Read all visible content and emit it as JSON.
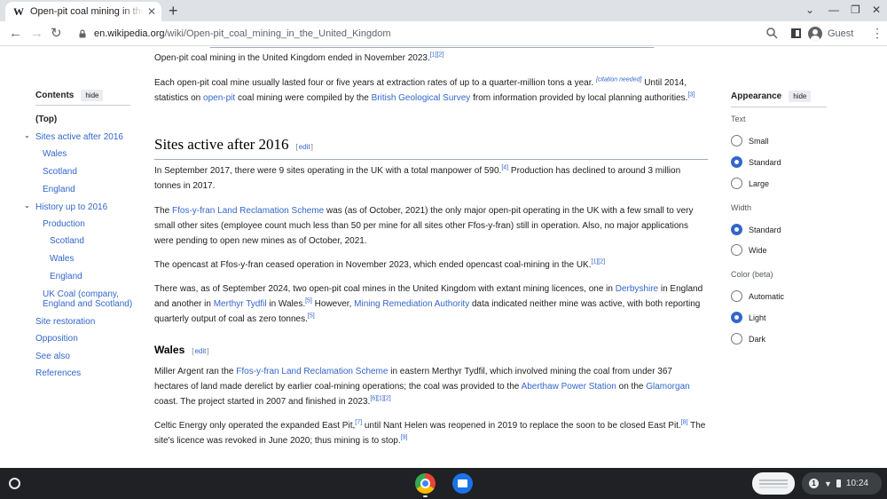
{
  "browser": {
    "tab_title": "Open-pit coal mining in the United Kingdom - Wikipedia",
    "favicon": "W",
    "new_tab": "+",
    "url_host": "en.wikipedia.org",
    "url_path": "/wiki/Open-pit_coal_mining_in_the_United_Kingdom",
    "profile": "Guest"
  },
  "toc": {
    "heading": "Contents",
    "hide": "hide",
    "items": [
      "(Top)",
      "Sites active after 2016",
      "Wales",
      "Scotland",
      "England",
      "History up to 2016",
      "Production",
      "Scotland",
      "Wales",
      "England",
      "UK Coal (company, England and Scotland)",
      "Site restoration",
      "Opposition",
      "See also",
      "References"
    ]
  },
  "article": {
    "p0": {
      "text": "Open-pit coal mining in the United Kingdom ended in November 2023.",
      "ref": "[1][2]"
    },
    "p1": {
      "a": "Each open-pit coal mine usually lasted four or five years at extraction rates of up to a quarter-million tons a year.",
      "cn": "[citation needed]",
      "b": " Until 2014, statistics on ",
      "link1": "open-pit",
      "c": " coal mining were compiled by the ",
      "link2": "British Geological Survey",
      "d": " from information provided by local planning authorities.",
      "ref": "[3]"
    },
    "h2": "Sites active after 2016",
    "edit": "edit",
    "p2": {
      "a": "In September 2017, there were 9 sites operating in the UK with a total manpower of 590.",
      "ref": "[4]",
      "b": " Production has declined to around 3 million tonnes in 2017."
    },
    "p3": {
      "a": "The ",
      "link": "Ffos-y-fran Land Reclamation Scheme",
      "b": " was (as of October, 2021) the only major open-pit operating in the UK with a few small to very small other sites (employee count much less than 50 per mine for all sites other Ffos-y-fran) still in operation. Also, no major applications were pending to open new mines as of October, 2021."
    },
    "p4": {
      "a": "The opencast at Ffos-y-fran ceased operation in November 2023, which ended opencast coal-mining in the UK.",
      "ref": "[1][2]"
    },
    "p5": {
      "a": "There was, as of September 2024, two open-pit coal mines in the United Kingdom with extant mining licences, one in ",
      "link1": "Derbyshire",
      "b": " in England and another in ",
      "link2": "Merthyr Tydfil",
      "c": " in Wales.",
      "ref1": "[5]",
      "d": " However, ",
      "link3": "Mining Remediation Authority",
      "e": " data indicated neither mine was active, with both reporting quarterly output of coal as zero tonnes.",
      "ref2": "[5]"
    },
    "h3": "Wales",
    "p6": {
      "a": "Miller Argent ran the ",
      "link1": "Ffos-y-fran Land Reclamation Scheme",
      "b": " in eastern Merthyr Tydfil, which involved mining the coal from under 367 hectares of land made derelict by earlier coal-mining operations; the coal was provided to the ",
      "link2": "Aberthaw Power Station",
      "c": " on the ",
      "link3": "Glamorgan",
      "d": " coast. The project started in 2007 and finished in 2023.",
      "ref": "[6][1][2]"
    },
    "p7": {
      "a": "Celtic Energy only operated the expanded East Pit,",
      "ref1": "[7]",
      "b": " until Nant Helen was reopened in 2019 to replace the soon to be closed East Pit.",
      "ref2": "[8]",
      "c": " The site's licence was revoked in June 2020; thus mining is to stop.",
      "ref3": "[9]"
    }
  },
  "appearance": {
    "heading": "Appearance",
    "hide": "hide",
    "text_label": "Text",
    "text_options": [
      "Small",
      "Standard",
      "Large"
    ],
    "width_label": "Width",
    "width_options": [
      "Standard",
      "Wide"
    ],
    "color_label": "Color (beta)",
    "color_options": [
      "Automatic",
      "Light",
      "Dark"
    ]
  },
  "shelf": {
    "notification_count": "1",
    "time": "10:24"
  },
  "colors": {
    "link": "#3366cc",
    "radio_selected": "#3366cc",
    "shelf": "#202124"
  }
}
